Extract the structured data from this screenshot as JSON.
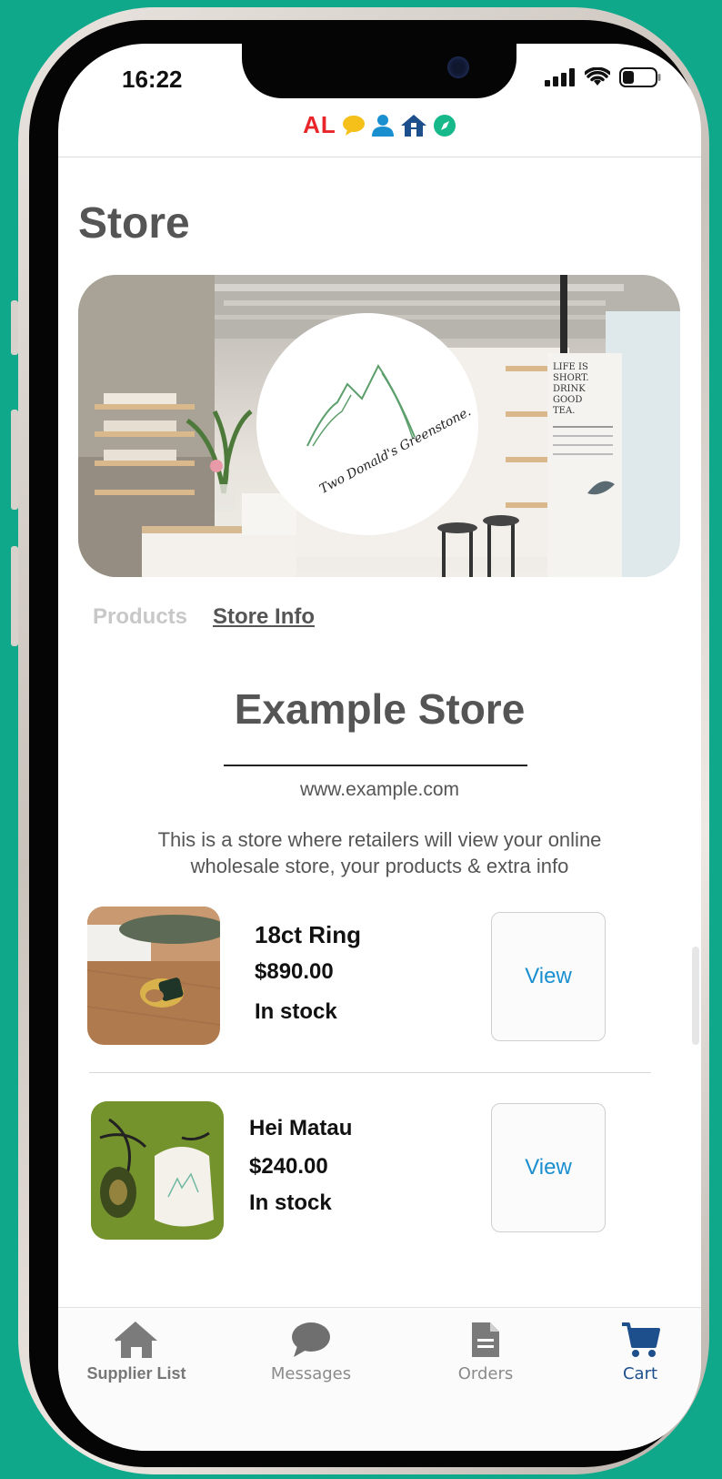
{
  "status_bar": {
    "time": "16:22"
  },
  "brand": {
    "logo_text": "AL"
  },
  "page": {
    "title": "Store"
  },
  "banner": {
    "logo_caption": "Two Donald's Greenstone."
  },
  "tabs": [
    {
      "label": "Products",
      "active": false
    },
    {
      "label": "Store Info",
      "active": true
    }
  ],
  "store": {
    "name": "Example Store",
    "url": "www.example.com",
    "description": "This is a store where retailers will view your online wholesale store, your products & extra info"
  },
  "products": [
    {
      "name": "18ct Ring",
      "price": "$890.00",
      "stock": "In stock",
      "action": "View"
    },
    {
      "name": "Hei Matau",
      "price": "$240.00",
      "stock": "In stock",
      "action": "View"
    }
  ],
  "bottom_nav": [
    {
      "label": "Supplier List",
      "icon": "home-icon"
    },
    {
      "label": "Messages",
      "icon": "chat-bubble-icon"
    },
    {
      "label": "Orders",
      "icon": "document-icon"
    },
    {
      "label": "Cart",
      "icon": "cart-icon",
      "active": true
    }
  ],
  "colors": {
    "accent_teal": "#0fa88a",
    "link_blue": "#1a8fd0",
    "nav_active": "#1c4f8c",
    "logo_red": "#e8262a"
  }
}
